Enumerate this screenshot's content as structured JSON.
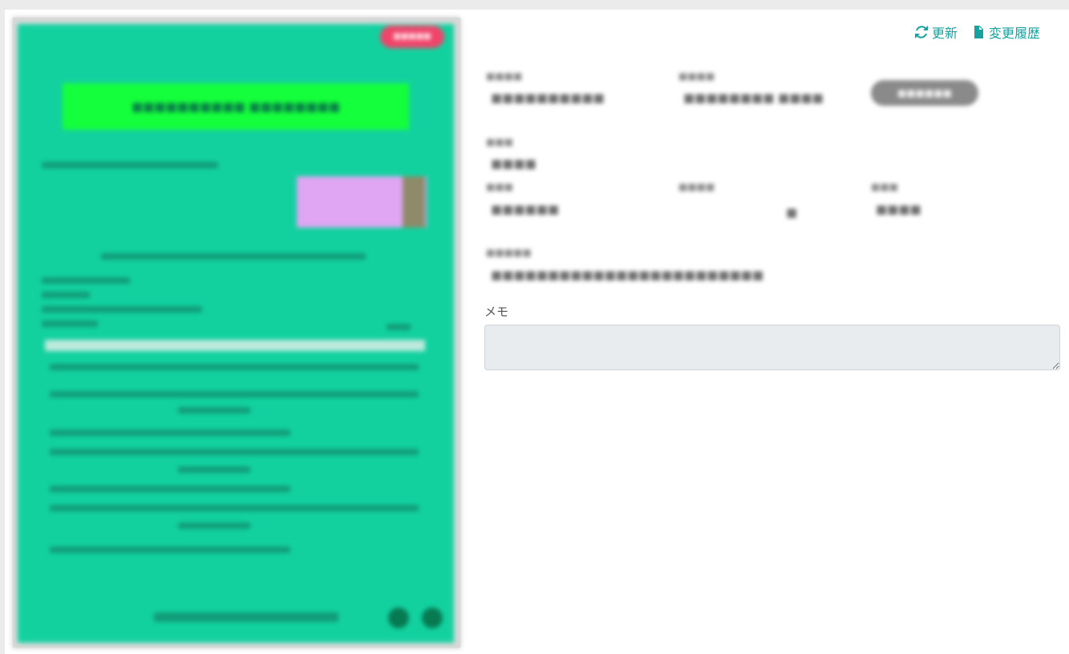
{
  "toolbar": {
    "refresh_label": "更新",
    "history_label": "変更履歴"
  },
  "document_preview": {
    "badge": "■■■■■",
    "title": "■■■■■■■■■■ ■■■■■■■■",
    "summary": "■■■■■■■■■■■■■■■■■■■■■■■■■■■■"
  },
  "details": {
    "doc_number_label": "■■■■",
    "doc_number": "■■■■■■■■■■",
    "registered_label": "■■■■",
    "registered_at": "■■■■■■■■ ■■■■",
    "status": "■■■■■■",
    "issuer_label": "■■■",
    "issuer": "■■■■",
    "date_label": "■■■",
    "date": "■■■■■■",
    "amount_label": "■■■■",
    "amount": "■",
    "type_label": "■■■",
    "type": "■■■■",
    "filename_label": "■■■■■",
    "filename": "■■■■■■■■■■■■■■■■■■■■■■■■"
  },
  "memo": {
    "label": "メモ",
    "value": ""
  }
}
